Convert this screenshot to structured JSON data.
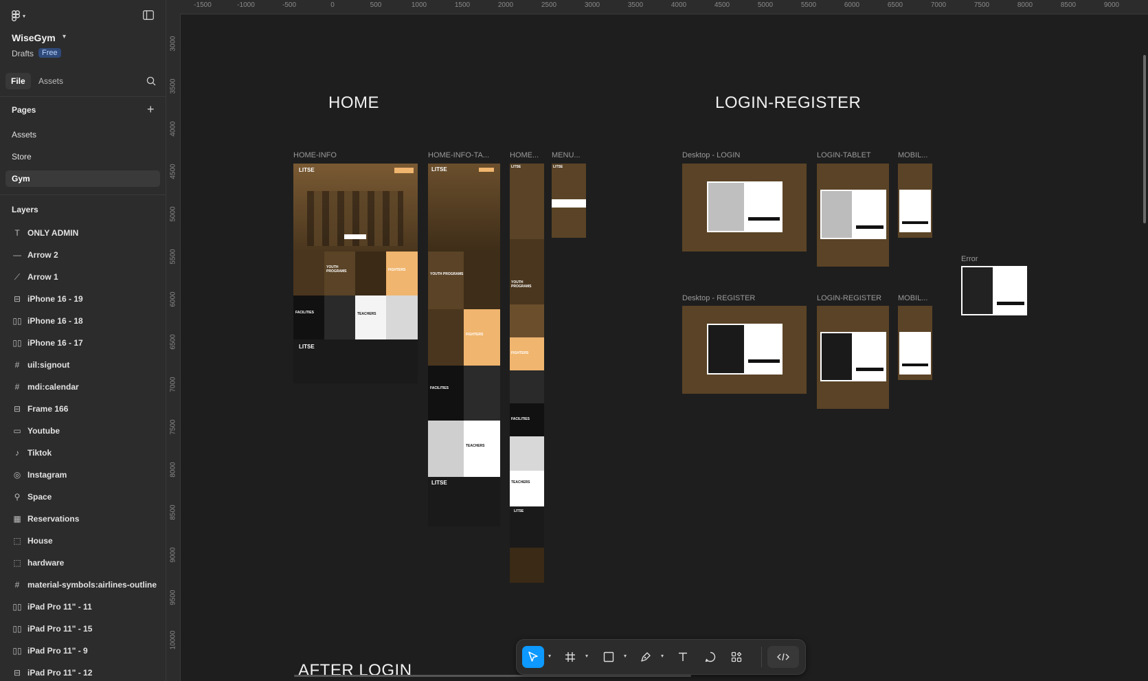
{
  "project": {
    "name": "WiseGym",
    "drafts": "Drafts",
    "plan_badge": "Free"
  },
  "tabs": [
    {
      "label": "File"
    },
    {
      "label": "Assets"
    }
  ],
  "pages": {
    "title": "Pages",
    "items": [
      {
        "label": "Assets"
      },
      {
        "label": "Store"
      },
      {
        "label": "Gym"
      }
    ]
  },
  "layers": {
    "title": "Layers",
    "items": [
      {
        "label": "ONLY ADMIN",
        "icon": "text-icon"
      },
      {
        "label": "Arrow 2",
        "icon": "line-icon"
      },
      {
        "label": "Arrow 1",
        "icon": "arrow-icon"
      },
      {
        "label": "iPhone 16 - 19",
        "icon": "frame-icon"
      },
      {
        "label": "iPhone 16 - 18",
        "icon": "autolayout-icon"
      },
      {
        "label": "iPhone 16 - 17",
        "icon": "autolayout-icon"
      },
      {
        "label": "uil:signout",
        "icon": "hash-icon"
      },
      {
        "label": "mdi:calendar",
        "icon": "hash-icon"
      },
      {
        "label": "Frame 166",
        "icon": "frame-icon"
      },
      {
        "label": "Youtube",
        "icon": "youtube-icon"
      },
      {
        "label": "Tiktok",
        "icon": "tiktok-icon"
      },
      {
        "label": "Instagram",
        "icon": "instagram-icon"
      },
      {
        "label": "Space",
        "icon": "pin-icon"
      },
      {
        "label": "Reservations",
        "icon": "grid-icon"
      },
      {
        "label": "House",
        "icon": "dashed-frame-icon"
      },
      {
        "label": "hardware",
        "icon": "dashed-frame-icon"
      },
      {
        "label": "material-symbols:airlines-outline",
        "icon": "hash-icon"
      },
      {
        "label": "iPad Pro 11\" - 11",
        "icon": "autolayout-icon"
      },
      {
        "label": "iPad Pro 11\" - 15",
        "icon": "autolayout-icon"
      },
      {
        "label": "iPad Pro 11\" - 9",
        "icon": "autolayout-icon"
      },
      {
        "label": "iPad Pro 11\" - 12",
        "icon": "frame-icon"
      }
    ]
  },
  "ruler": {
    "top": [
      "-1500",
      "-1000",
      "-500",
      "0",
      "500",
      "1000",
      "1500",
      "2000",
      "2500",
      "3000",
      "3500",
      "4000",
      "4500",
      "5000",
      "5500",
      "6000",
      "6500",
      "7000",
      "7500",
      "8000",
      "8500",
      "9000"
    ],
    "left": [
      "3000",
      "3500",
      "4000",
      "4500",
      "5000",
      "5500",
      "6000",
      "6500",
      "7000",
      "7500",
      "8000",
      "8500",
      "9000",
      "9500",
      "10000"
    ]
  },
  "canvas": {
    "sections": {
      "home": "HOME",
      "login": "LOGIN-REGISTER",
      "after": "AFTER LOGIN"
    },
    "frame_labels": {
      "home_info": "HOME-INFO",
      "home_info_tablet": "HOME-INFO-TA...",
      "home_mobile": "HOME...",
      "menu": "MENU...",
      "desktop_login": "Desktop - LOGIN",
      "login_tablet": "LOGIN-TABLET",
      "mobile_login": "MOBIL...",
      "error": "Error",
      "desktop_register": "Desktop - REGISTER",
      "login_register": "LOGIN-REGISTER",
      "mobile_register": "MOBIL..."
    },
    "thumb_text": {
      "youth": "YOUTH PROGRAMS",
      "fighters": "FIGHTERS",
      "facilities": "FACILITIES",
      "teachers": "TEACHERS",
      "brand": "LITSE"
    }
  },
  "colors": {
    "accent": "#0d99ff",
    "gold": "#f0b56e",
    "sepia": "#5a4326",
    "dark": "#1a1a1a"
  }
}
